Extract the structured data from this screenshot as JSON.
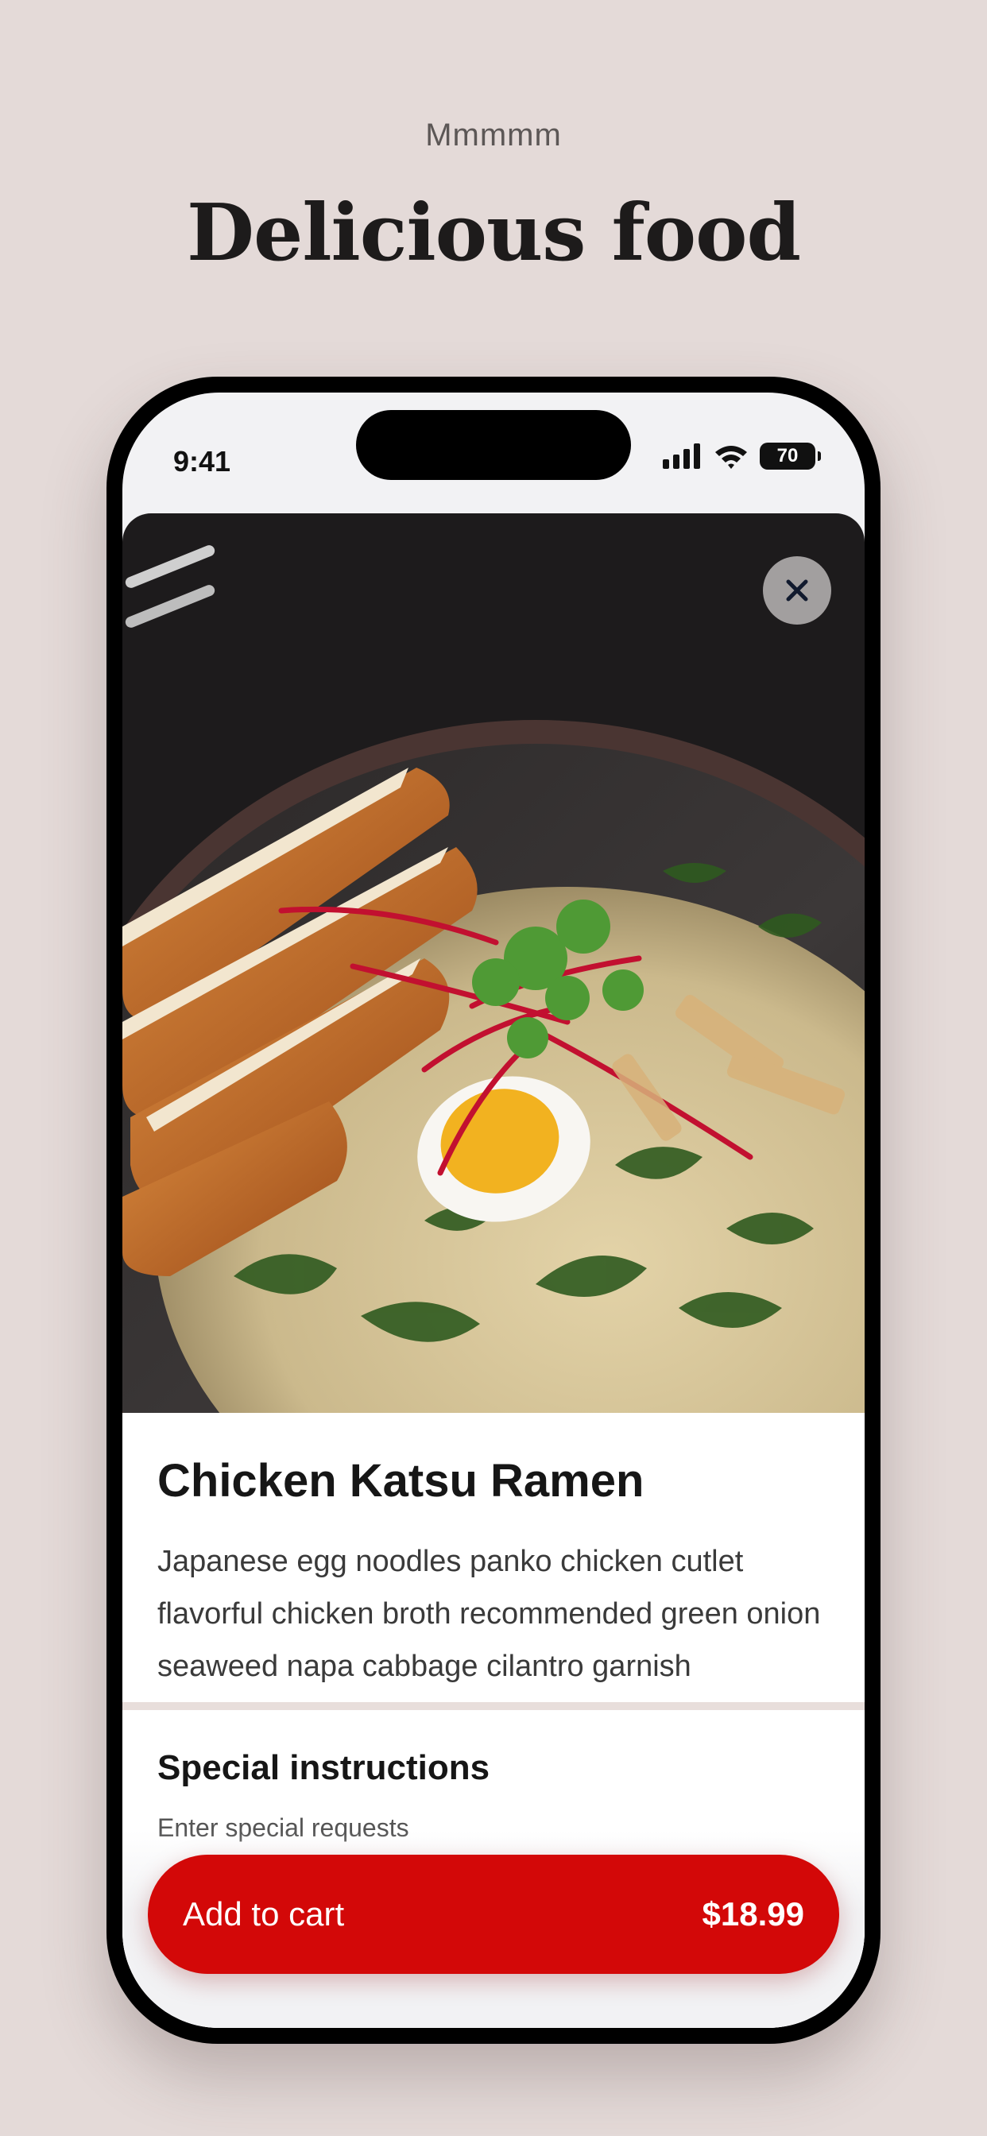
{
  "header": {
    "eyebrow": "Mmmmm",
    "title": "Delicious food"
  },
  "status_bar": {
    "time": "9:41",
    "battery": "70"
  },
  "product": {
    "name": "Chicken Katsu Ramen",
    "description": "Japanese egg noodles panko chicken cutlet flavorful chicken broth recommended green onion seaweed napa cabbage cilantro garnish"
  },
  "special_instructions": {
    "title": "Special instructions",
    "placeholder": "Enter special requests"
  },
  "cart": {
    "label": "Add to cart",
    "price": "$18.99"
  },
  "colors": {
    "background": "#e4dad8",
    "accent": "#d30808"
  },
  "icons": {
    "close": "close-icon",
    "signal": "cellular-signal-icon",
    "wifi": "wifi-icon",
    "battery": "battery-icon"
  }
}
